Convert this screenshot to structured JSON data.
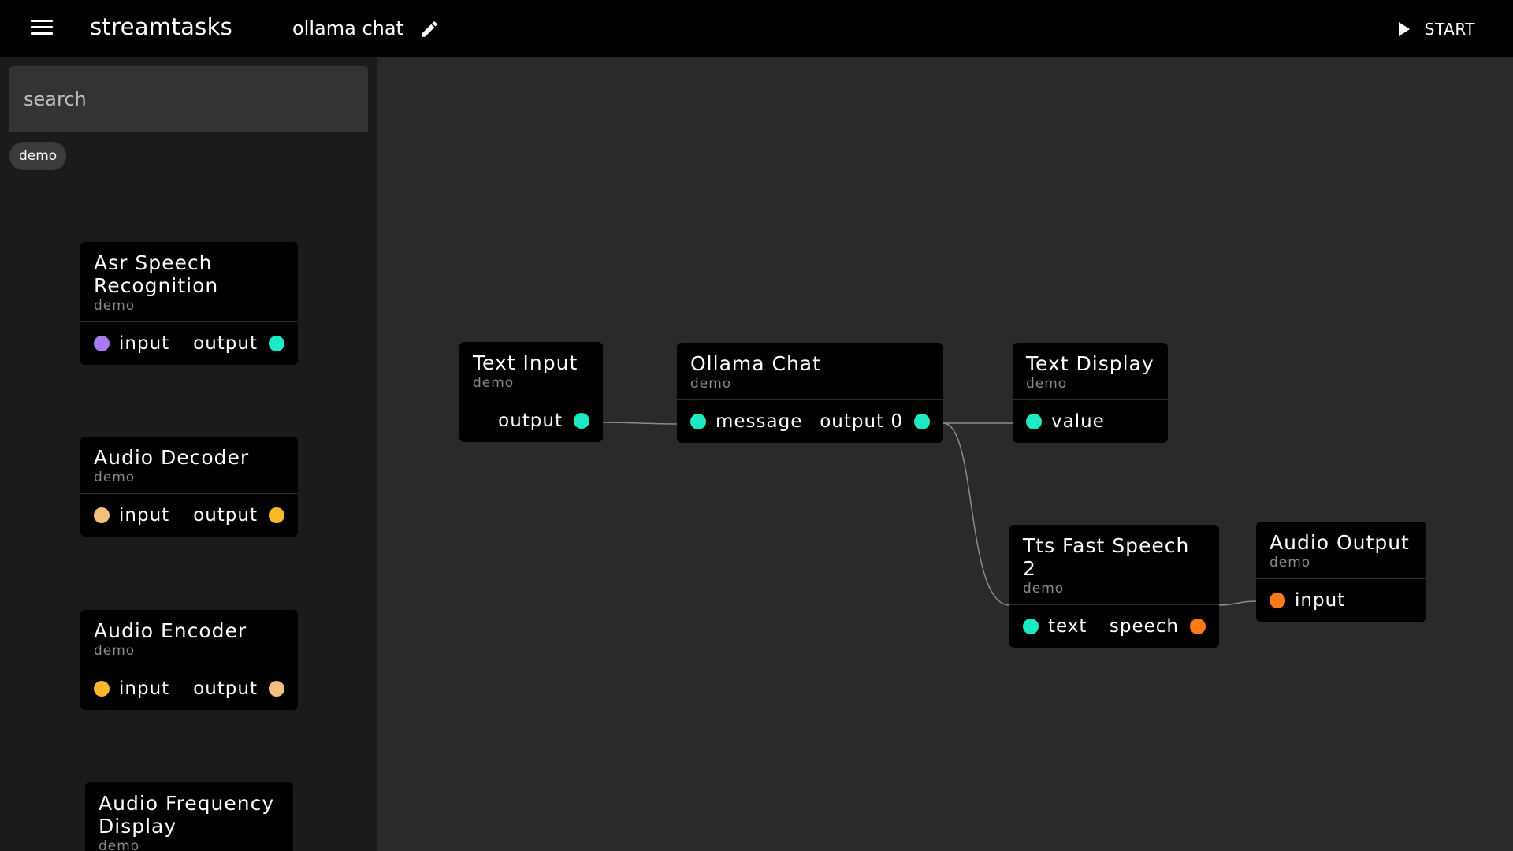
{
  "header": {
    "brand": "streamtasks",
    "flow_title": "ollama chat",
    "start_label": "START",
    "menu_icon": "hamburger-menu-icon",
    "edit_icon": "pencil-icon",
    "start_icon": "play-icon"
  },
  "sidebar": {
    "search_placeholder": "search",
    "filter_chip": "demo",
    "items": [
      {
        "title": "Asr Speech Recognition",
        "category": "demo",
        "input": "input",
        "output": "output",
        "input_color": "#a77bf2",
        "output_color": "#1de9c5"
      },
      {
        "title": "Audio Decoder",
        "category": "demo",
        "input": "input",
        "output": "output",
        "input_color": "#f3c17c",
        "output_color": "#fbb82b"
      },
      {
        "title": "Audio Encoder",
        "category": "demo",
        "input": "input",
        "output": "output",
        "input_color": "#fbb82b",
        "output_color": "#f3c17c"
      },
      {
        "title": "Audio Frequency Display",
        "category": "demo"
      }
    ]
  },
  "canvas": {
    "nodes": {
      "text_input": {
        "title": "Text Input",
        "category": "demo",
        "output": "output",
        "output_color": "#1de9c5"
      },
      "ollama_chat": {
        "title": "Ollama Chat",
        "category": "demo",
        "input": "message",
        "output": "output 0",
        "input_color": "#1de9c5",
        "output_color": "#1de9c5"
      },
      "text_display": {
        "title": "Text Display",
        "category": "demo",
        "input": "value",
        "input_color": "#1de9c5"
      },
      "tts": {
        "title": "Tts Fast Speech 2",
        "category": "demo",
        "input": "text",
        "output": "speech",
        "input_color": "#1de9c5",
        "output_color": "#ff7a1a"
      },
      "audio_output": {
        "title": "Audio Output",
        "category": "demo",
        "input": "input",
        "input_color": "#ff7a1a"
      }
    },
    "connection_color": "#8c8c8c"
  }
}
